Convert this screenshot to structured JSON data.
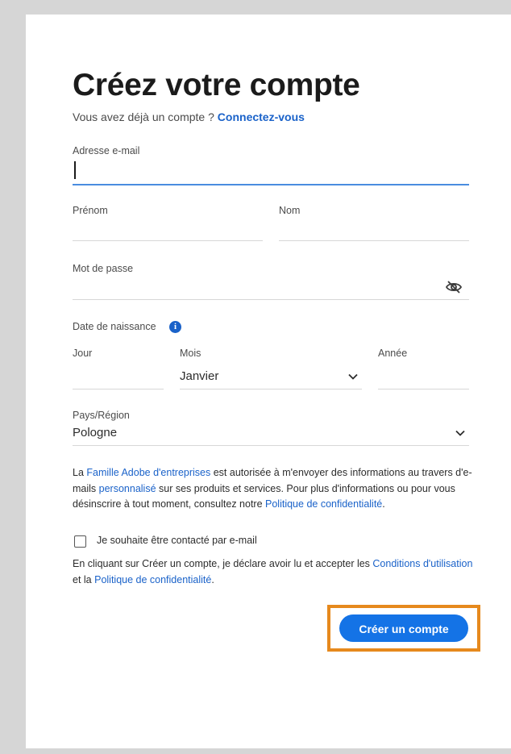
{
  "title": "Créez votre compte",
  "subtitle": {
    "text": "Vous avez déjà un compte ?",
    "link": "Connectez-vous"
  },
  "email": {
    "label": "Adresse e-mail",
    "value": ""
  },
  "first_name": {
    "label": "Prénom",
    "value": ""
  },
  "last_name": {
    "label": "Nom",
    "value": ""
  },
  "password": {
    "label": "Mot de passe",
    "value": "",
    "toggle_icon": "eye-slash-icon"
  },
  "birthdate": {
    "label": "Date de naissance",
    "info_icon": "info-icon",
    "day": {
      "label": "Jour",
      "value": ""
    },
    "month": {
      "label": "Mois",
      "value": "Janvier"
    },
    "year": {
      "label": "Année",
      "value": ""
    }
  },
  "country": {
    "label": "Pays/Région",
    "value": "Pologne"
  },
  "consent": {
    "t1": "La ",
    "l1": "Famille Adobe d'entreprises",
    "t2": " est autorisée à m'envoyer des informations au travers d'e-mails ",
    "l2": "personnalisé",
    "t3": " sur ses produits et services. Pour plus d'informations ou pour vous désinscrire à tout moment, consultez notre ",
    "l3": "Politique de confidentialité",
    "t4": "."
  },
  "checkbox": {
    "label": "Je souhaite être contacté par e-mail",
    "checked": false
  },
  "terms": {
    "t1": "En cliquant sur Créer un compte, je déclare avoir lu et accepter les ",
    "l1": "Conditions d'utilisation",
    "t2": " et la ",
    "l2": "Politique de confidentialité",
    "t3": "."
  },
  "submit_label": "Créer un compte",
  "colors": {
    "accent": "#1473e6",
    "link": "#1a62c9",
    "highlight": "#e6891d"
  }
}
